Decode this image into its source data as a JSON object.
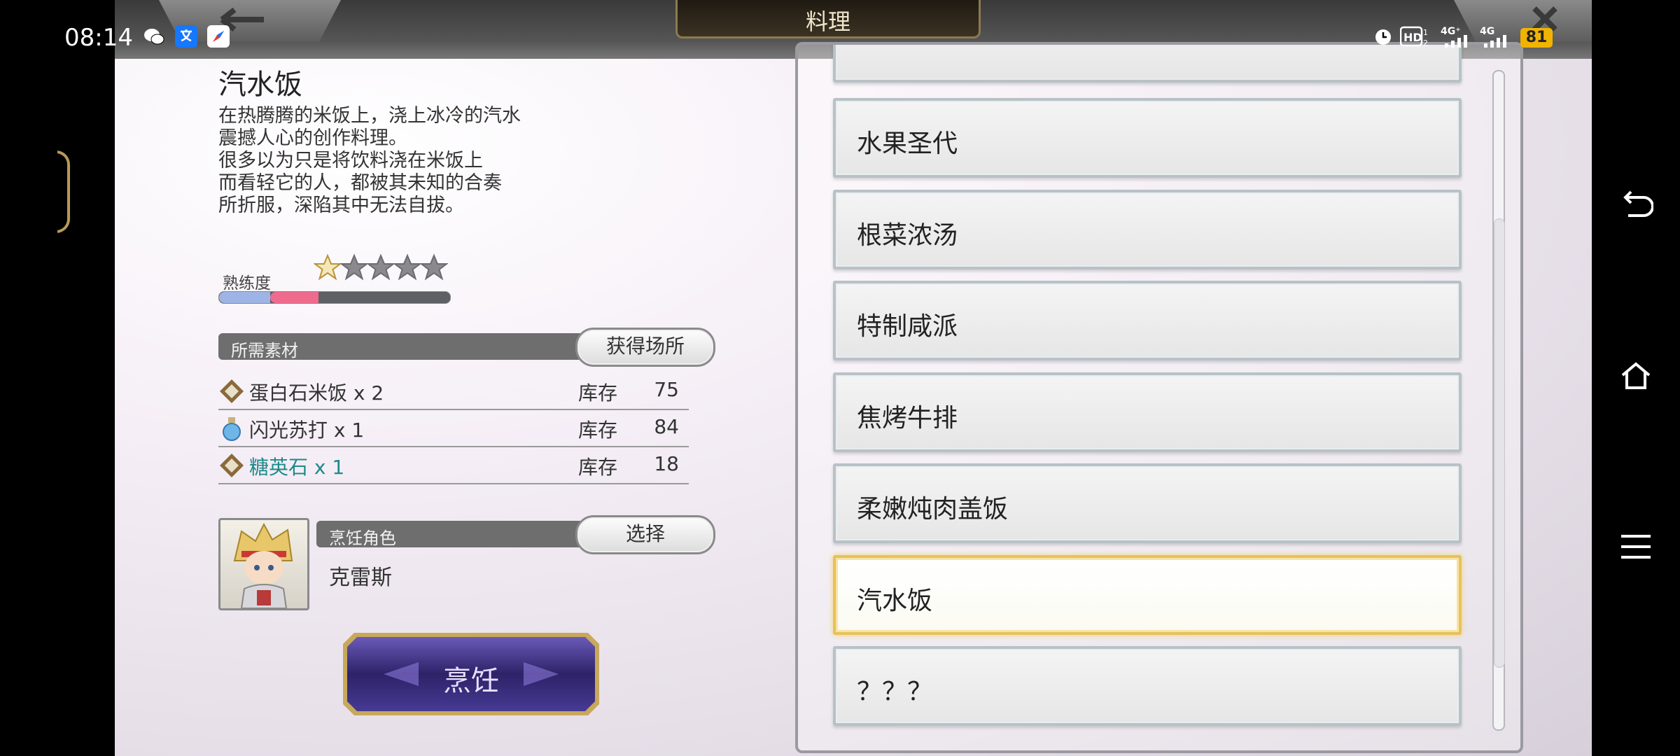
{
  "status_bar": {
    "time": "08:14",
    "battery": "81",
    "network": [
      "4G⁺",
      "4G"
    ]
  },
  "header": {
    "title": "料理"
  },
  "detail": {
    "dish_name": "汽水饭",
    "description": [
      "在热腾腾的米饭上，浇上冰冷的汽水",
      "震撼人心的创作料理。",
      "很多以为只是将饮料浇在米饭上",
      "而看轻它的人，都被其未知的合奏",
      "所折服，深陷其中无法自拔。"
    ],
    "proficiency": {
      "label": "熟练度",
      "stars_filled": 1,
      "stars_total": 5,
      "bar_blue_fraction": 0.22,
      "bar_pink_fraction": 0.43
    },
    "materials": {
      "header": "所需素材",
      "source_button": "获得场所",
      "stock_label": "库存",
      "items": [
        {
          "name": "蛋白石米饭 x 2",
          "stock": "75",
          "icon": "gem-icon",
          "color": "#333333"
        },
        {
          "name": "闪光苏打 x 1",
          "stock": "84",
          "icon": "potion-bottle-icon",
          "color": "#333333"
        },
        {
          "name": "糖英石 x 1",
          "stock": "18",
          "icon": "gem-icon",
          "color": "#1d8a8a"
        }
      ]
    },
    "cook_role": {
      "header": "烹饪角色",
      "select_button": "选择",
      "character_name": "克雷斯"
    },
    "cook_button": "烹饪"
  },
  "recipe_list": {
    "items": [
      {
        "label": "水果圣代",
        "selected": false
      },
      {
        "label": "根菜浓汤",
        "selected": false
      },
      {
        "label": "特制咸派",
        "selected": false
      },
      {
        "label": "焦烤牛排",
        "selected": false
      },
      {
        "label": "柔嫩炖肉盖饭",
        "selected": false
      },
      {
        "label": "汽水饭",
        "selected": true
      },
      {
        "label": "？？？",
        "selected": false
      }
    ],
    "scroll_fraction": 0.7
  },
  "colors": {
    "accent_gold": "#e7c25b",
    "prof_blue": "#9fb4e6",
    "prof_pink": "#ee6b8e",
    "cook_button_purple": "#3b2a7a"
  }
}
